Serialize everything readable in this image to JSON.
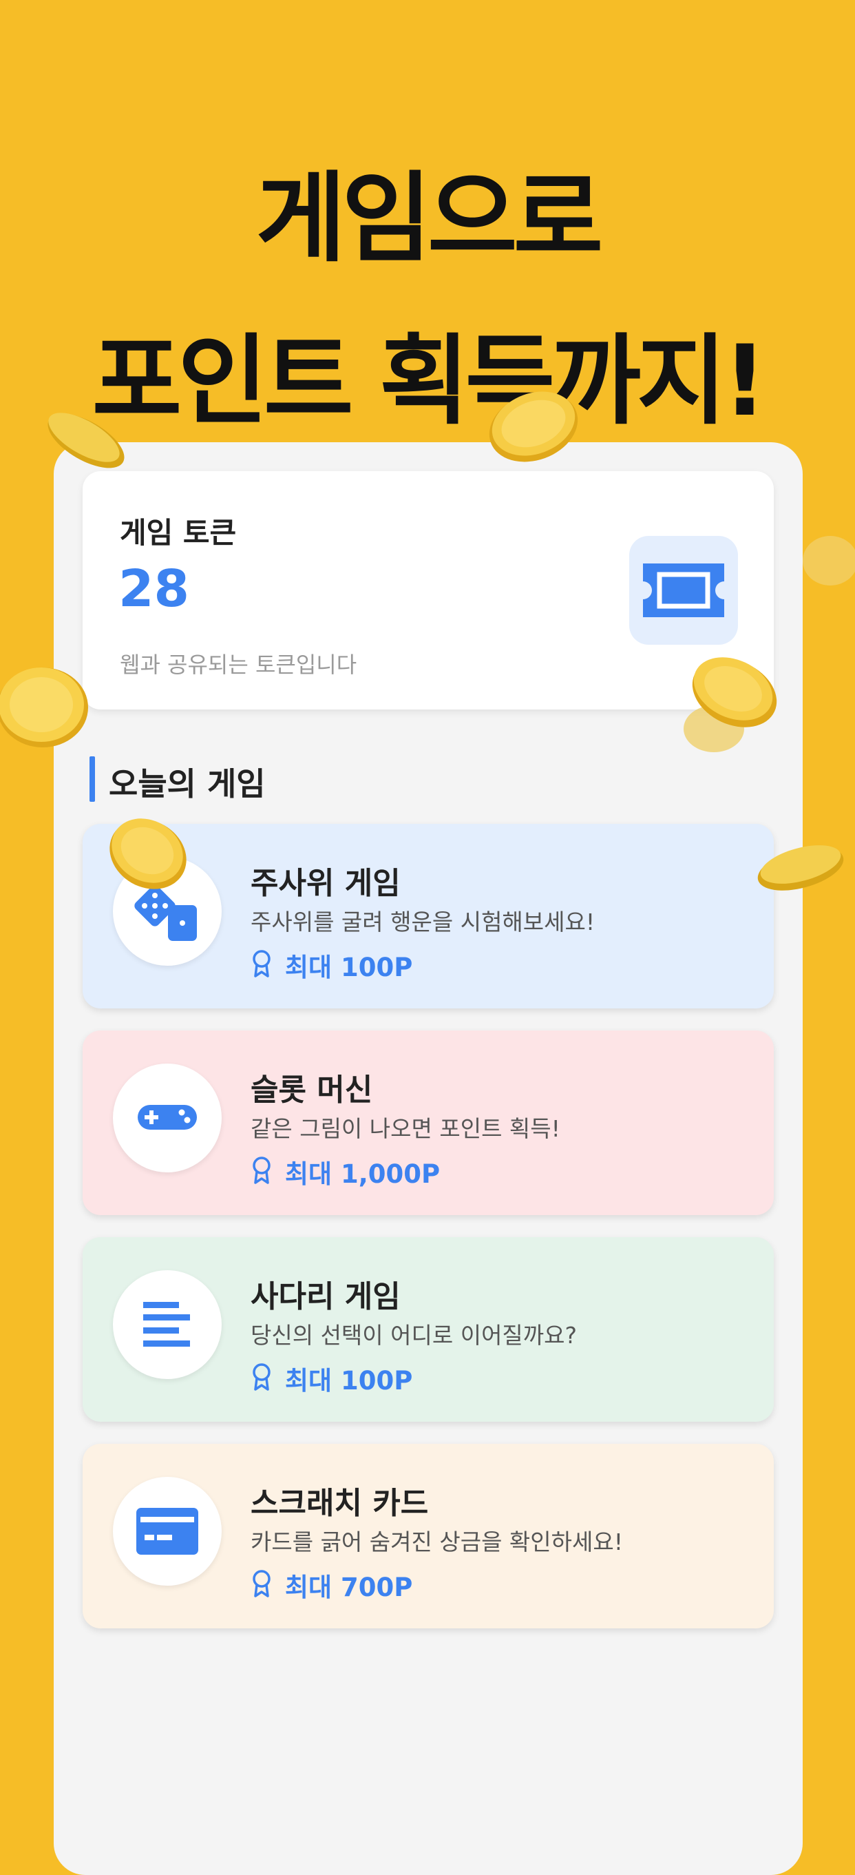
{
  "headline": {
    "line1": "게임으로",
    "line2": "포인트 획득까지!"
  },
  "token_card": {
    "title": "게임 토큰",
    "count": "28",
    "description": "웹과 공유되는 토큰입니다",
    "icon": "ticket-icon"
  },
  "section": {
    "title": "오늘의 게임"
  },
  "games": [
    {
      "title": "주사위 게임",
      "description": "주사위를 굴려 행운을 시험해보세요!",
      "reward": "최대 100P",
      "icon": "dice-icon",
      "bg": "#E3EEFD"
    },
    {
      "title": "슬롯 머신",
      "description": "같은 그림이 나오면 포인트 획득!",
      "reward": "최대 1,000P",
      "icon": "gamepad-icon",
      "bg": "#FDE4E6"
    },
    {
      "title": "사다리 게임",
      "description": "당신의 선택이 어디로 이어질까요?",
      "reward": "최대 100P",
      "icon": "ladder-lines-icon",
      "bg": "#E4F3EA"
    },
    {
      "title": "스크래치 카드",
      "description": "카드를 긁어 숨겨진 상금을 확인하세요!",
      "reward": "최대 700P",
      "icon": "card-icon",
      "bg": "#FDF2E4"
    }
  ],
  "colors": {
    "background": "#F6BD27",
    "accent": "#3C82F0"
  }
}
